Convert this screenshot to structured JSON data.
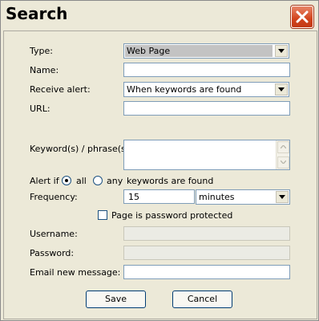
{
  "window": {
    "title": "Search"
  },
  "form": {
    "type_label": "Type:",
    "type_value": "Web Page",
    "name_label": "Name:",
    "name_value": "",
    "receive_alert_label": "Receive alert:",
    "receive_alert_value": "When keywords are found",
    "url_label": "URL:",
    "url_value": "",
    "keywords_label": "Keyword(s) / phrase(s):",
    "keywords_value": "",
    "alert_if_label": "Alert if",
    "alert_all_label": "all",
    "alert_any_label": "any",
    "alert_suffix": "keywords are found",
    "alert_selected": "all",
    "frequency_label": "Frequency:",
    "frequency_value": "15",
    "frequency_unit": "minutes",
    "password_protected_label": "Page is password protected",
    "password_protected_checked": false,
    "username_label": "Username:",
    "password_label": "Password:",
    "email_label": "Email new message:",
    "email_value": ""
  },
  "buttons": {
    "save": "Save",
    "cancel": "Cancel"
  },
  "colors": {
    "close_button": "#d2441d",
    "field_border": "#7f9db9",
    "background": "#ece9d8"
  }
}
